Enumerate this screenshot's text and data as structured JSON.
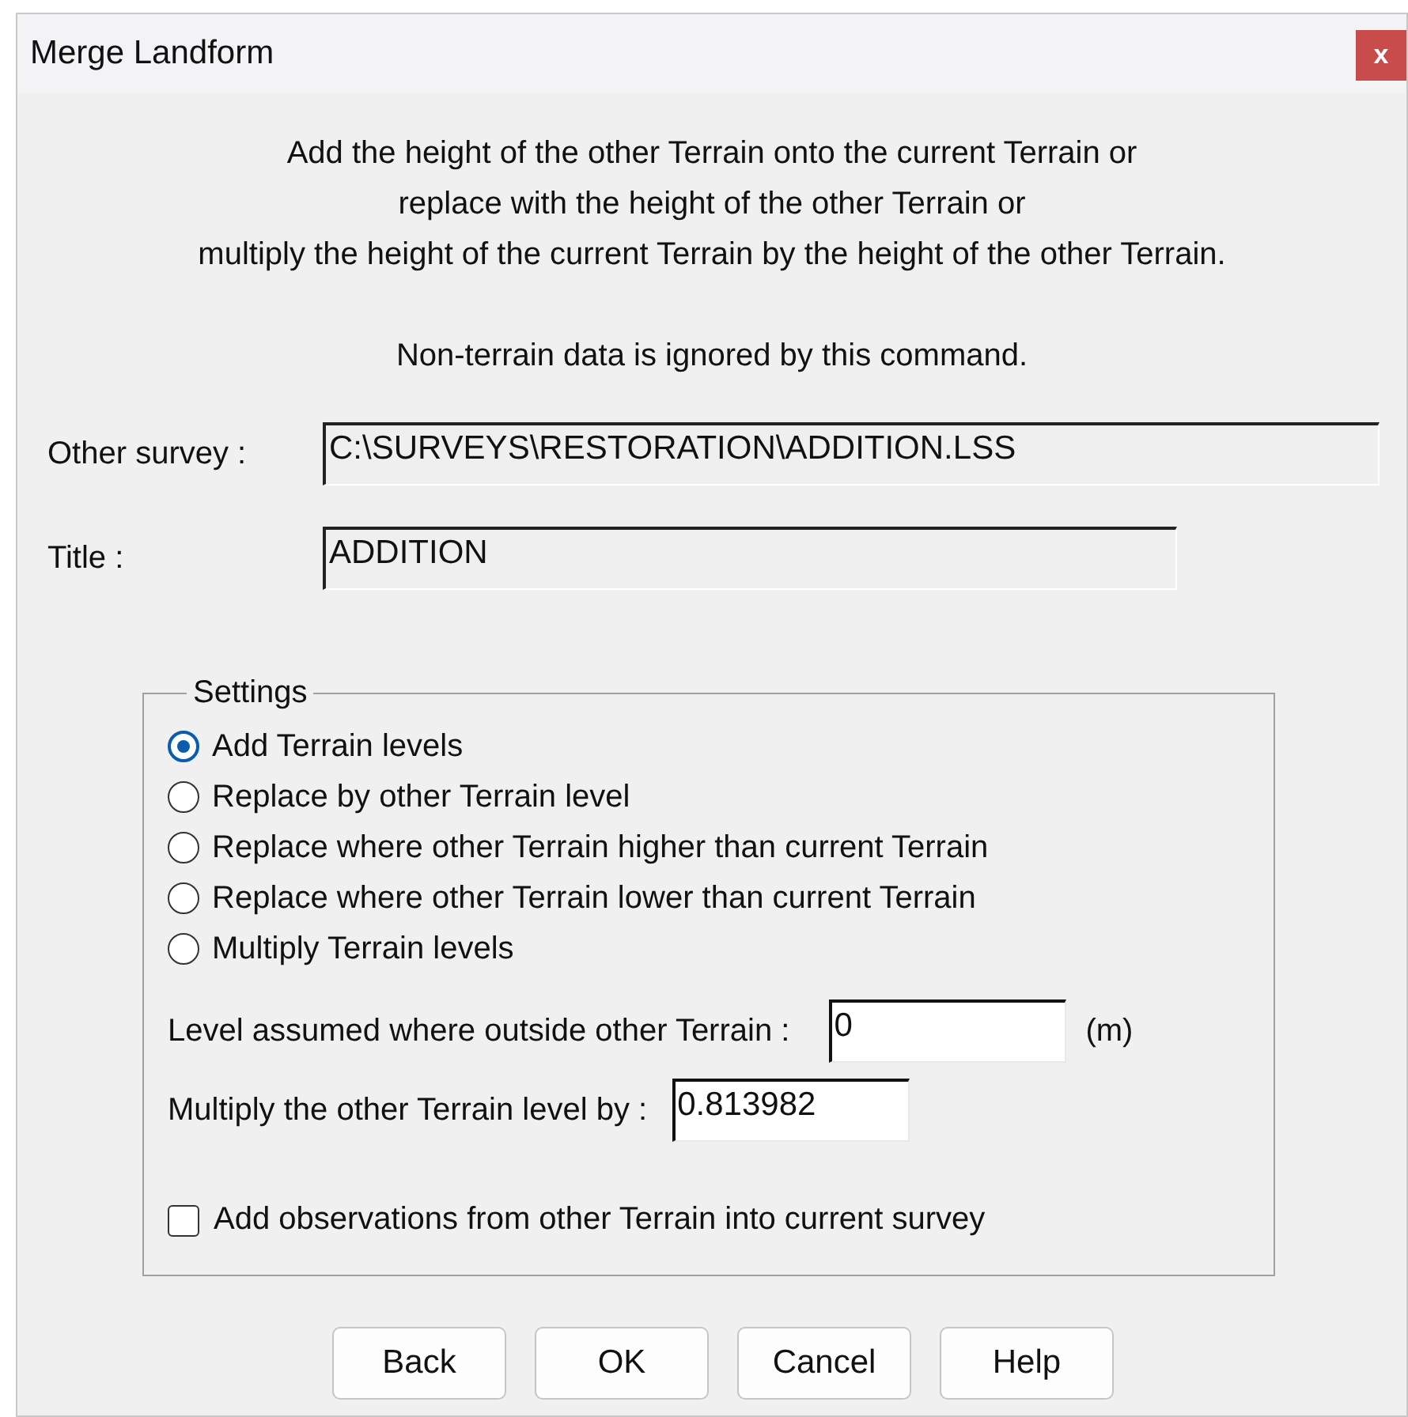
{
  "window": {
    "title": "Merge Landform",
    "close": "x"
  },
  "description": [
    "Add the height of the other Terrain onto the current Terrain or",
    "replace with the height of the other Terrain or",
    "multiply the height of the current Terrain by the height of the other Terrain."
  ],
  "note": "Non-terrain data is ignored by this command.",
  "fields": [
    {
      "label": "Other survey :",
      "value": "C:\\SURVEYS\\RESTORATION\\ADDITION.LSS",
      "kind": "wide"
    },
    {
      "label": "Title :",
      "value": "ADDITION",
      "kind": "medium"
    }
  ],
  "settings": {
    "title": "Settings",
    "options": [
      {
        "label": "Add Terrain levels",
        "selected": true
      },
      {
        "label": "Replace by other Terrain level",
        "selected": false
      },
      {
        "label": "Replace where other Terrain higher than current Terrain",
        "selected": false
      },
      {
        "label": "Replace where other Terrain lower than current Terrain",
        "selected": false
      },
      {
        "label": "Multiply Terrain levels",
        "selected": false
      }
    ],
    "level_outside": {
      "label": "Level assumed where outside other Terrain :",
      "value": "0",
      "unit": "(m)"
    },
    "multiply_by": {
      "label": "Multiply the other Terrain level by :",
      "value": "0.813982"
    },
    "add_observations": {
      "label": "Add observations from other Terrain into current survey",
      "checked": false
    }
  },
  "buttons": [
    "Back",
    "OK",
    "Cancel",
    "Help"
  ]
}
